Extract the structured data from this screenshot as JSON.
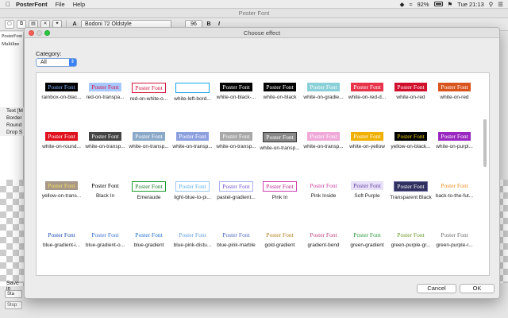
{
  "menubar": {
    "app_name": "PosterFont",
    "items": [
      "File",
      "Help"
    ],
    "battery": "92%",
    "clock": "Tue 21:13"
  },
  "app": {
    "title": "Poster Font",
    "font_name": "Bodoni 72 Oldstyle",
    "font_size": "96",
    "bold_label": "B",
    "italic_label": "I",
    "left_text": [
      "PosterFont",
      "Multiline"
    ],
    "props": [
      "Text [M",
      "Border",
      "Round",
      "Drop S"
    ],
    "save_label": "Save in",
    "start_label": "Sta",
    "stop_label": "Stop"
  },
  "dialog": {
    "title": "Choose effect",
    "category_label": "Category:",
    "category_value": "All",
    "cancel_label": "Cancel",
    "ok_label": "OK",
    "sample_text": "Poster Font"
  },
  "effects": [
    {
      "label": "rainbox-on-blac...",
      "bg": "#000000",
      "fg": "#7fb3ff"
    },
    {
      "label": "red-on-transpa...",
      "bg": "#a7c7ff",
      "fg": "#d4143c"
    },
    {
      "label": "red-on-white-o...",
      "bg": "#ffffff",
      "fg": "#d4143c",
      "border": "#d4143c"
    },
    {
      "label": "white-left-bord...",
      "bg": "#ffffff",
      "fg": "#ffffff",
      "border": "#1aa3e8"
    },
    {
      "label": "white-on-black-...",
      "bg": "#000000",
      "fg": "#ffffff"
    },
    {
      "label": "white-on-black",
      "bg": "#000000",
      "fg": "#ffffff"
    },
    {
      "label": "white-on-gradie...",
      "bg": "#8ad0d8",
      "fg": "#ffffff"
    },
    {
      "label": "white-on-red-d...",
      "bg": "#e8344a",
      "fg": "#ffffff"
    },
    {
      "label": "white-on-red",
      "bg": "#d0102c",
      "fg": "#ffffff"
    },
    {
      "label": "white-on-red",
      "bg": "#d9541c",
      "fg": "#ffffff"
    },
    {
      "label": "white-on-round...",
      "bg": "#e0101c",
      "fg": "#ffffff"
    },
    {
      "label": "white-on-transp...",
      "bg": "#444444",
      "fg": "#ffffff"
    },
    {
      "label": "white-on-transp...",
      "bg": "#8aa8c8",
      "fg": "#ffffff"
    },
    {
      "label": "white-on-transp...",
      "bg": "#8ca0e0",
      "fg": "#ffffff"
    },
    {
      "label": "white-on-transp...",
      "bg": "#a8a8a8",
      "fg": "#ffffff"
    },
    {
      "label": "white-on-transp...",
      "bg": "#888888",
      "fg": "#ffffff",
      "border": "#333333"
    },
    {
      "label": "white-on-transp...",
      "bg": "#f0a8d8",
      "fg": "#ffffff"
    },
    {
      "label": "white-on-yellow",
      "bg": "#f0b000",
      "fg": "#ffffff"
    },
    {
      "label": "yellow-on-black...",
      "bg": "#000000",
      "fg": "#f0d000"
    },
    {
      "label": "white-on-purpl...",
      "bg": "#9a28c0",
      "fg": "#ffffff"
    },
    {
      "label": "yellow-on-trans...",
      "bg": "#a89888",
      "fg": "#f0e060"
    },
    {
      "label": "Black In",
      "bg": "#ffffff",
      "fg": "#000000"
    },
    {
      "label": "Emeraude",
      "bg": "#ffffff",
      "fg": "#1a7a2a",
      "border": "#1a9a2a"
    },
    {
      "label": "light-blue-to-pi...",
      "bg": "#ffffff",
      "fg": "#5ab0f0",
      "border": "#9ac8f0"
    },
    {
      "label": "pastel-gradient...",
      "bg": "#ffffff",
      "fg": "#7050d0",
      "border": "#a8b0f0"
    },
    {
      "label": "Pink In",
      "bg": "#ffffff",
      "fg": "#c02890",
      "border": "#d040b0"
    },
    {
      "label": "Pink Inside",
      "bg": "#ffffff",
      "fg": "#d040a0"
    },
    {
      "label": "Soft Purple",
      "bg": "#e8e0f8",
      "fg": "#6040a0"
    },
    {
      "label": "Transparent Black",
      "bg": "#303060",
      "fg": "#ffffff",
      "border": "#6a6aa0"
    },
    {
      "label": "back-to-the-fut...",
      "bg": "#ffffff",
      "fg": "#f09020"
    },
    {
      "label": "blue-gradient-i...",
      "bg": "#ffffff",
      "fg": "#1a4ab0"
    },
    {
      "label": "blue-gradient-o...",
      "bg": "#ffffff",
      "fg": "#3a70d0"
    },
    {
      "label": "blue-gradient",
      "bg": "#ffffff",
      "fg": "#2070d0"
    },
    {
      "label": "blue-pink-distu...",
      "bg": "#ffffff",
      "fg": "#60a0e0"
    },
    {
      "label": "blue-pink-marble",
      "bg": "#ffffff",
      "fg": "#5068c0"
    },
    {
      "label": "gold-gradient",
      "bg": "#ffffff",
      "fg": "#b08020"
    },
    {
      "label": "gradient-bend",
      "bg": "#ffffff",
      "fg": "#c04880"
    },
    {
      "label": "green-gradient",
      "bg": "#ffffff",
      "fg": "#2a9a3a"
    },
    {
      "label": "green-purple-gr...",
      "bg": "#ffffff",
      "fg": "#6a9a2a"
    },
    {
      "label": "green-purple-r...",
      "bg": "#ffffff",
      "fg": "#707070"
    }
  ]
}
